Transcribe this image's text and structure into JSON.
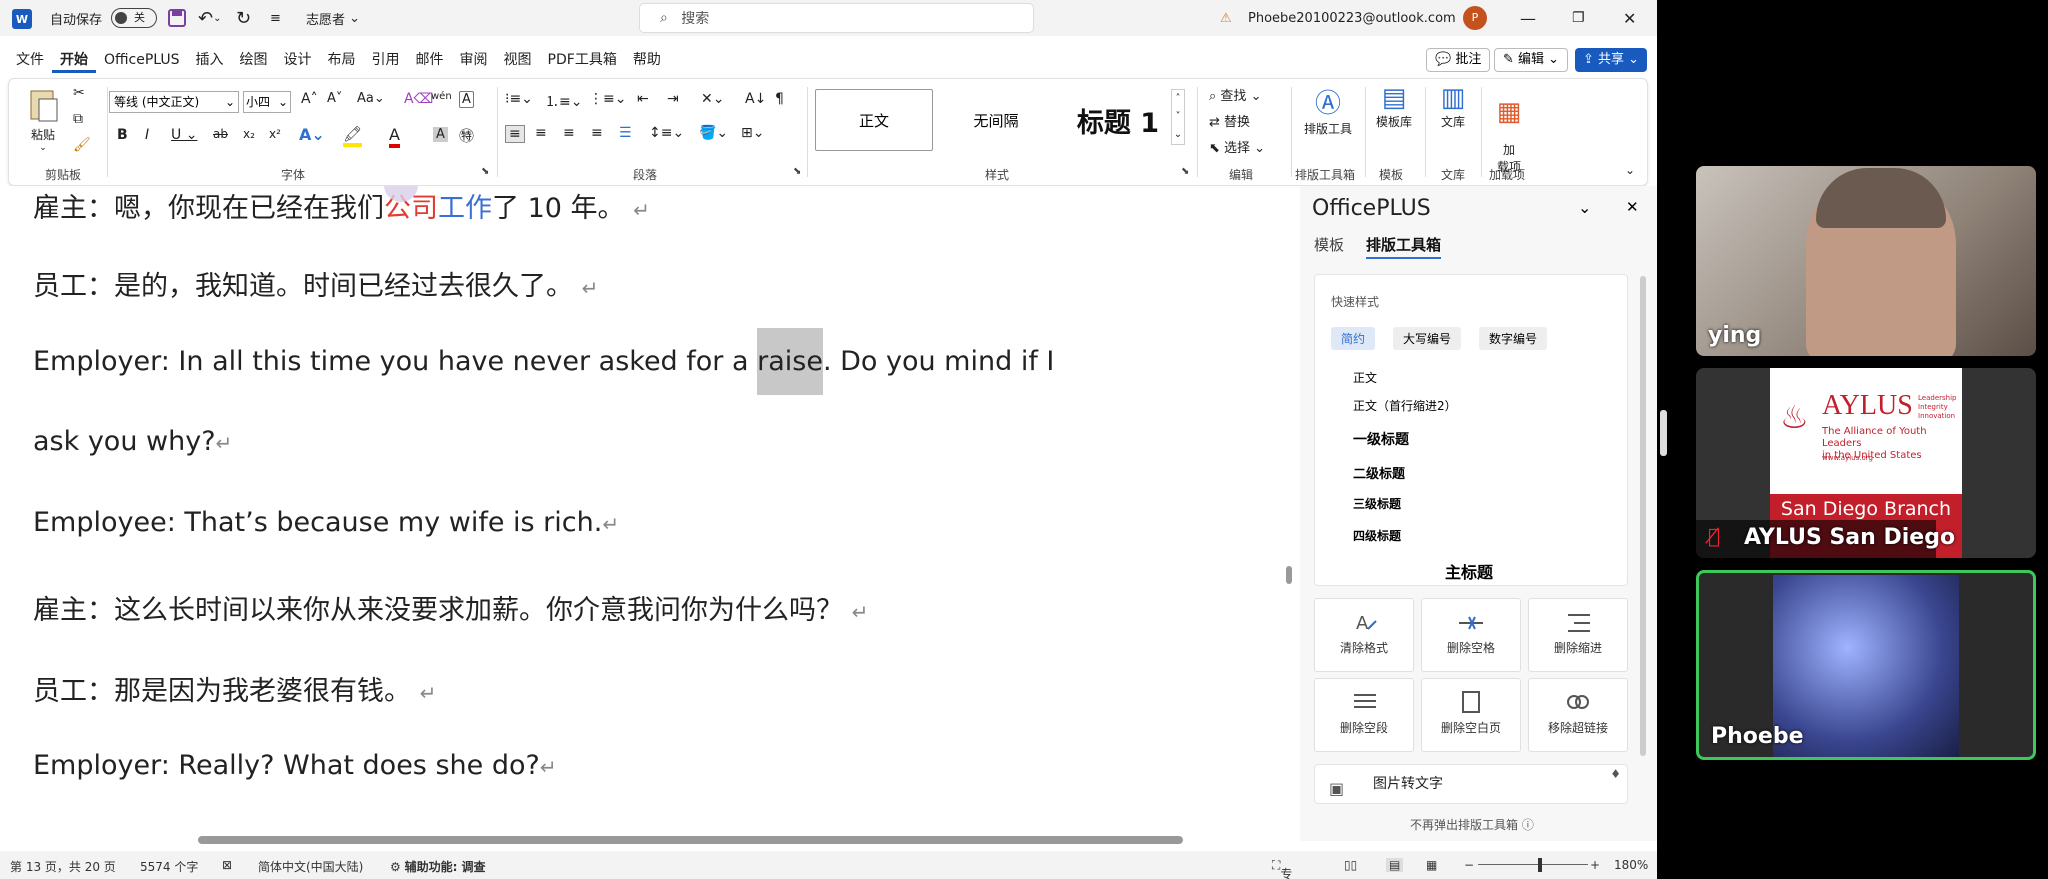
{
  "titlebar": {
    "logo": "W",
    "autosave": "自动保存",
    "autosave_state": "关",
    "profile_label": "志愿者",
    "search_placeholder": "搜索",
    "account": "Phoebe20100223@outlook.com",
    "avatar": "P"
  },
  "menu": [
    "文件",
    "开始",
    "OfficePLUS",
    "插入",
    "绘图",
    "设计",
    "布局",
    "引用",
    "邮件",
    "审阅",
    "视图",
    "PDF工具箱",
    "帮助"
  ],
  "menu_right": {
    "comment": "批注",
    "edit": "编辑",
    "share": "共享"
  },
  "ribbon": {
    "paste": "粘贴",
    "clipboard": "剪贴板",
    "font_name": "等线 (中文正文)",
    "font_size": "小四",
    "font": "字体",
    "paragraph": "段落",
    "styles_label": "样式",
    "styles": [
      "正文",
      "无间隔",
      "标题 1"
    ],
    "find": "查找",
    "replace": "替换",
    "select": "选择",
    "editing": "编辑",
    "layout_tool": "排版工具",
    "layout_group": "排版工具箱",
    "template_lib": "模板库",
    "template_group": "模板",
    "library": "文库",
    "library_group": "文库",
    "addin": "加\n载项",
    "addin_group": "加载项"
  },
  "doc": {
    "l1_a": "雇主：嗯，你现在已经在我们",
    "l1_b": "公司",
    "l1_c": "工作",
    "l1_d": "了  10  年。",
    "l2": "员工：是的，我知道。时间已经过去很久了。",
    "l3_a": "Employer: In all this time you have never asked for a ",
    "l3_b": "raise",
    "l3_c": ". Do you mind if I",
    "l4": "ask you why?",
    "l5": "Employee: That’s because my wife is rich.",
    "l6": "雇主：这么长时间以来你从来没要求加薪。你介意我问你为什么吗？",
    "l7": "员工：那是因为我老婆很有钱。",
    "l8": "Employer: Really? What does she do?",
    "para_mark": "↵"
  },
  "panel": {
    "title": "OfficePLUS",
    "tabs": [
      "模板",
      "排版工具箱"
    ],
    "quick_style": "快速样式",
    "chips": [
      "简约",
      "大写编号",
      "数字编号"
    ],
    "style_items": [
      "正文",
      "正文（首行缩进2）",
      "一级标题",
      "二级标题",
      "三级标题",
      "四级标题",
      "主标题"
    ],
    "cards": [
      "清除格式",
      "删除空格",
      "删除缩进",
      "删除空段",
      "删除空白页",
      "移除超链接"
    ],
    "image_to_text": "图片转文字",
    "footer": "不再弹出排版工具箱"
  },
  "status": {
    "page": "第 13 页，共 20 页",
    "words": "5574 个字",
    "lang": "简体中文(中国大陆)",
    "access": "辅助功能: 调查",
    "focus": "专注",
    "zoom": "180%"
  },
  "videos": [
    {
      "name": "ying"
    },
    {
      "name": "AYLUS San Diego",
      "logo": "AYLUS",
      "tag1": "Leadership",
      "tag2": "Integrity",
      "tag3": "Innovation",
      "sub1": "The Alliance of Youth Leaders",
      "sub2": "in the United States",
      "url": "www.aylus.org",
      "branch": "San Diego Branch"
    },
    {
      "name": "Phoebe"
    }
  ],
  "colors": {
    "accent": "#185abd",
    "active_border": "#3cc85a"
  }
}
